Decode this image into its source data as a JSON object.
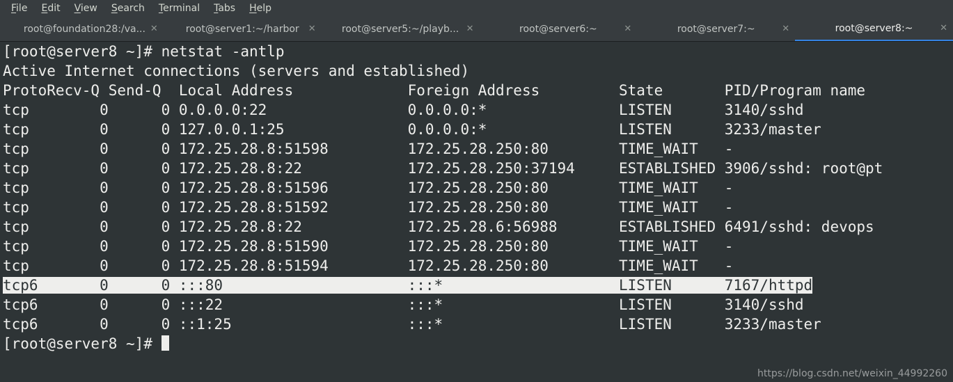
{
  "menubar": {
    "items": [
      "File",
      "Edit",
      "View",
      "Search",
      "Terminal",
      "Tabs",
      "Help"
    ]
  },
  "tabs": {
    "items": [
      {
        "label": "root@foundation28:/va...",
        "active": false
      },
      {
        "label": "root@server1:~/harbor",
        "active": false
      },
      {
        "label": "root@server5:~/playb...",
        "active": false
      },
      {
        "label": "root@server6:~",
        "active": false
      },
      {
        "label": "root@server7:~",
        "active": false
      },
      {
        "label": "root@server8:~",
        "active": true
      }
    ]
  },
  "terminal": {
    "prompt": "[root@server8 ~]# ",
    "command": "netstat -antlp",
    "subtitle": "Active Internet connections (servers and established)",
    "header": {
      "proto": "Proto",
      "recvq": "Recv-Q",
      "sendq": "Send-Q",
      "local": "Local Address",
      "foreign": "Foreign Address",
      "state": "State",
      "pid": "PID/Program name"
    },
    "rows": [
      {
        "proto": "tcp",
        "recvq": "0",
        "sendq": "0",
        "local": "0.0.0.0:22",
        "foreign": "0.0.0.0:*",
        "state": "LISTEN",
        "pid": "3140/sshd",
        "hl": false
      },
      {
        "proto": "tcp",
        "recvq": "0",
        "sendq": "0",
        "local": "127.0.0.1:25",
        "foreign": "0.0.0.0:*",
        "state": "LISTEN",
        "pid": "3233/master",
        "hl": false
      },
      {
        "proto": "tcp",
        "recvq": "0",
        "sendq": "0",
        "local": "172.25.28.8:51598",
        "foreign": "172.25.28.250:80",
        "state": "TIME_WAIT",
        "pid": "-",
        "hl": false
      },
      {
        "proto": "tcp",
        "recvq": "0",
        "sendq": "0",
        "local": "172.25.28.8:22",
        "foreign": "172.25.28.250:37194",
        "state": "ESTABLISHED",
        "pid": "3906/sshd: root@pt",
        "hl": false
      },
      {
        "proto": "tcp",
        "recvq": "0",
        "sendq": "0",
        "local": "172.25.28.8:51596",
        "foreign": "172.25.28.250:80",
        "state": "TIME_WAIT",
        "pid": "-",
        "hl": false
      },
      {
        "proto": "tcp",
        "recvq": "0",
        "sendq": "0",
        "local": "172.25.28.8:51592",
        "foreign": "172.25.28.250:80",
        "state": "TIME_WAIT",
        "pid": "-",
        "hl": false
      },
      {
        "proto": "tcp",
        "recvq": "0",
        "sendq": "0",
        "local": "172.25.28.8:22",
        "foreign": "172.25.28.6:56988",
        "state": "ESTABLISHED",
        "pid": "6491/sshd: devops",
        "hl": false
      },
      {
        "proto": "tcp",
        "recvq": "0",
        "sendq": "0",
        "local": "172.25.28.8:51590",
        "foreign": "172.25.28.250:80",
        "state": "TIME_WAIT",
        "pid": "-",
        "hl": false
      },
      {
        "proto": "tcp",
        "recvq": "0",
        "sendq": "0",
        "local": "172.25.28.8:51594",
        "foreign": "172.25.28.250:80",
        "state": "TIME_WAIT",
        "pid": "-",
        "hl": false
      },
      {
        "proto": "tcp6",
        "recvq": "0",
        "sendq": "0",
        "local": ":::80",
        "foreign": ":::*",
        "state": "LISTEN",
        "pid": "7167/httpd",
        "hl": true
      },
      {
        "proto": "tcp6",
        "recvq": "0",
        "sendq": "0",
        "local": ":::22",
        "foreign": ":::*",
        "state": "LISTEN",
        "pid": "3140/sshd",
        "hl": false
      },
      {
        "proto": "tcp6",
        "recvq": "0",
        "sendq": "0",
        "local": "::1:25",
        "foreign": ":::*",
        "state": "LISTEN",
        "pid": "3233/master",
        "hl": false
      }
    ],
    "prompt2": "[root@server8 ~]# "
  },
  "watermark": "https://blog.csdn.net/weixin_44992260"
}
